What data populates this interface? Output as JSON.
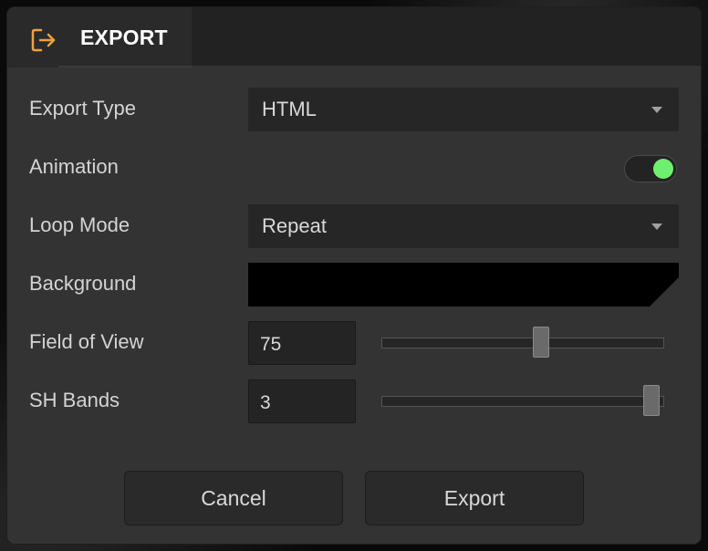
{
  "dialog": {
    "title": "EXPORT",
    "icon": "export-arrow-icon",
    "accent_color": "#f0a040"
  },
  "fields": {
    "export_type": {
      "label": "Export Type",
      "value": "HTML"
    },
    "animation": {
      "label": "Animation",
      "enabled": true,
      "toggle_color": "#6ef06e"
    },
    "loop_mode": {
      "label": "Loop Mode",
      "value": "Repeat"
    },
    "background": {
      "label": "Background",
      "color": "#000000"
    },
    "field_of_view": {
      "label": "Field of View",
      "value": "75",
      "slider_fraction": 0.57
    },
    "sh_bands": {
      "label": "SH Bands",
      "value": "3",
      "slider_fraction": 1.0
    }
  },
  "buttons": {
    "cancel": "Cancel",
    "export": "Export"
  }
}
